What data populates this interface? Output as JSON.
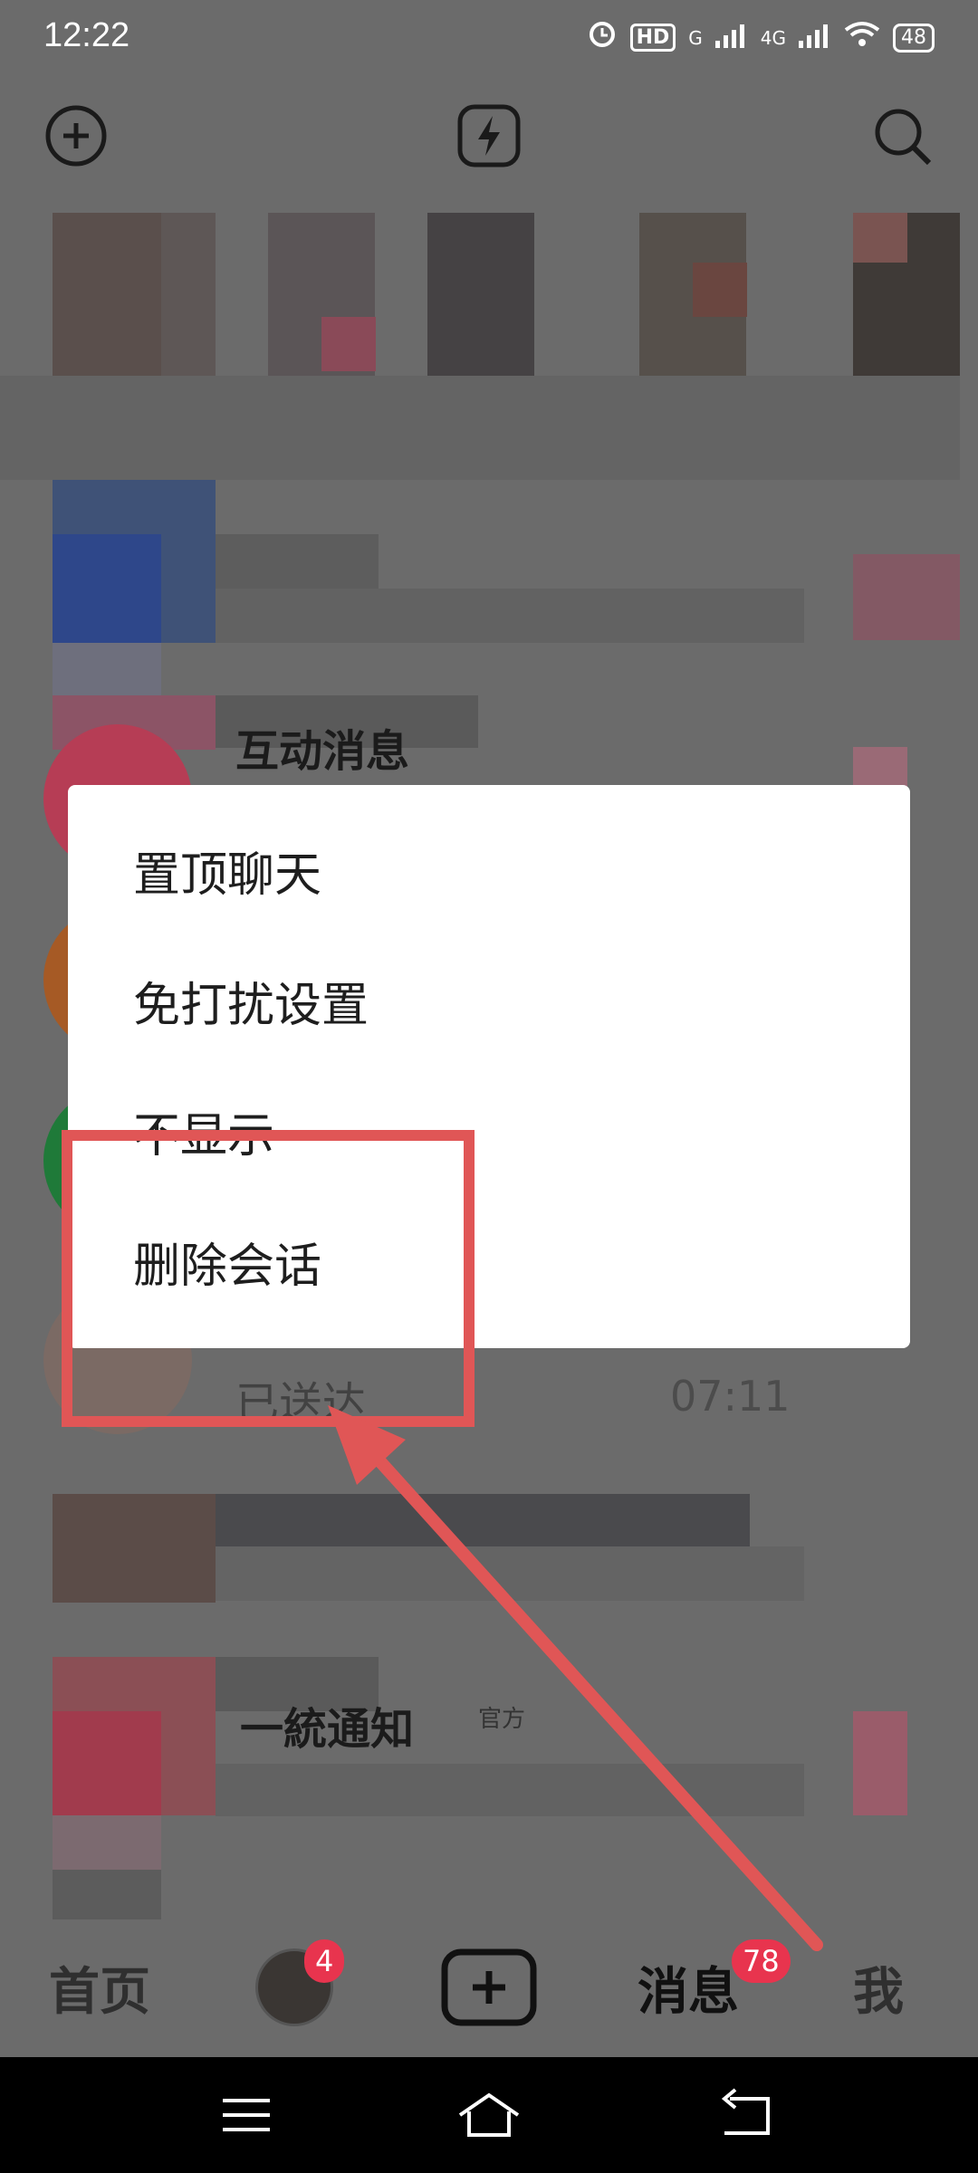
{
  "status_bar": {
    "time": "12:22",
    "hd_label": "HD",
    "network_1": "G",
    "network_2": "4G",
    "battery": "48"
  },
  "top_bar": {
    "add_icon": "plus-circle-icon",
    "flash_icon": "lightning-icon",
    "search_icon": "search-icon"
  },
  "background_list": {
    "item_interaction_title": "互动消息",
    "item_partial_title": "已送达",
    "item_partial_time": "07:11",
    "item_official_title": "一統通知",
    "official_tag": "官方"
  },
  "context_menu": {
    "items": [
      {
        "label": "置顶聊天"
      },
      {
        "label": "免打扰设置"
      },
      {
        "label": "不显示"
      },
      {
        "label": "删除会话"
      }
    ]
  },
  "tab_bar": {
    "home": "首页",
    "friends_badge": "4",
    "publish_icon": "plus-square-icon",
    "messages": "消息",
    "messages_badge": "78",
    "me": "我"
  },
  "nav_bar": {
    "menu_icon": "menu-icon",
    "home_icon": "home-icon",
    "back_icon": "back-icon"
  },
  "colors": {
    "overlay_bg": "#6b6b6b",
    "annotation_red": "#e05656",
    "badge_red": "#e8344e"
  }
}
